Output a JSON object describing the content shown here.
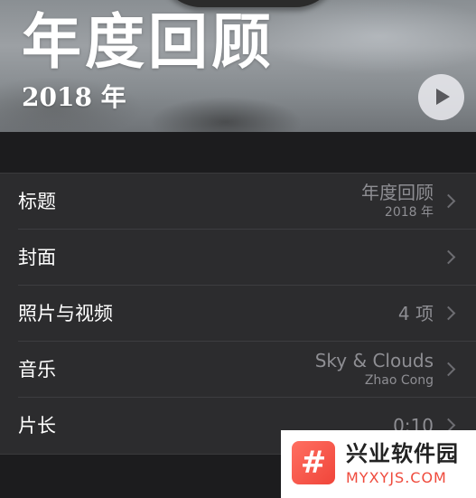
{
  "hero": {
    "title": "年度回顾",
    "subtitle": "2018 年"
  },
  "rows": [
    {
      "label": "标题",
      "value": "年度回顾",
      "subvalue": "2018 年"
    },
    {
      "label": "封面",
      "value": ""
    },
    {
      "label": "照片与视频",
      "value": "4 项"
    },
    {
      "label": "音乐",
      "value": "Sky & Clouds",
      "subvalue": "Zhao Cong"
    },
    {
      "label": "片长",
      "value": "0:10"
    }
  ],
  "watermark": {
    "name": "兴业软件园",
    "url": "MYXYJS.COM",
    "logo_glyph": "#"
  },
  "colors": {
    "background": "#1c1c1e",
    "list_background": "#2c2c2e",
    "primary_text": "#ffffff",
    "secondary_text": "#8e8e93",
    "watermark_accent": "#ef4a3c"
  }
}
